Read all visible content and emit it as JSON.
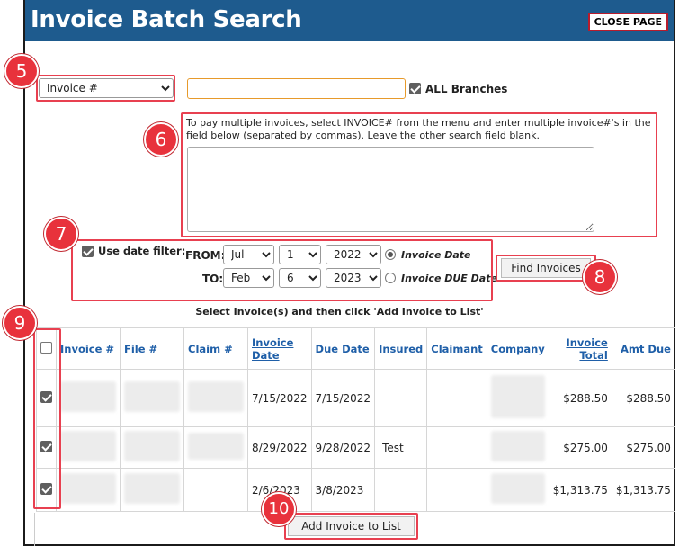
{
  "header": {
    "title": "Invoice Batch Search",
    "close_label": "CLOSE PAGE"
  },
  "search": {
    "field_selected": "Invoice #",
    "input_value": "",
    "all_branches_label": "ALL Branches",
    "all_branches_checked": true,
    "hint": "To pay multiple invoices, select INVOICE# from the menu and enter multiple invoice#'s in the field below (separated by commas). Leave the other search field blank.",
    "multi_value": ""
  },
  "date_filter": {
    "label": "Use date filter:",
    "checked": true,
    "from_label": "FROM:",
    "to_label": "TO:",
    "from": {
      "month": "Jul",
      "day": "1",
      "year": "2022"
    },
    "to": {
      "month": "Feb",
      "day": "6",
      "year": "2023"
    },
    "option_invoice_date": "Invoice Date",
    "option_due_date": "Invoice DUE Date",
    "selected_option": "Invoice Date"
  },
  "find_label": "Find Invoices",
  "table": {
    "caption": "Select Invoice(s) and then click 'Add Invoice to List'",
    "headers": {
      "invoice": "Invoice #",
      "file": "File #",
      "claim": "Claim #",
      "invoice_date": "Invoice Date",
      "due_date": "Due Date",
      "insured": "Insured",
      "claimant": "Claimant",
      "company": "Company",
      "invoice_total": "Invoice Total",
      "amt_due": "Amt Due"
    },
    "rows": [
      {
        "checked": true,
        "invoice_date": "7/15/2022",
        "due_date": "7/15/2022",
        "insured": "",
        "claimant": "",
        "invoice_total": "$288.50",
        "amt_due": "$288.50"
      },
      {
        "checked": true,
        "invoice_date": "8/29/2022",
        "due_date": "9/28/2022",
        "insured": "Test",
        "claimant": "",
        "invoice_total": "$275.00",
        "amt_due": "$275.00"
      },
      {
        "checked": true,
        "invoice_date": "2/6/2023",
        "due_date": "3/8/2023",
        "insured": "",
        "claimant": "",
        "invoice_total": "$1,313.75",
        "amt_due": "$1,313.75"
      }
    ]
  },
  "add_label": "Add Invoice to List",
  "callouts": {
    "c5": "5",
    "c6": "6",
    "c7": "7",
    "c8": "8",
    "c9": "9",
    "c10": "10"
  },
  "colors": {
    "header_bg": "#1e5b8e",
    "callout": "#e8323c",
    "link": "#1f5fa8",
    "input_focus": "#e79a2b"
  }
}
